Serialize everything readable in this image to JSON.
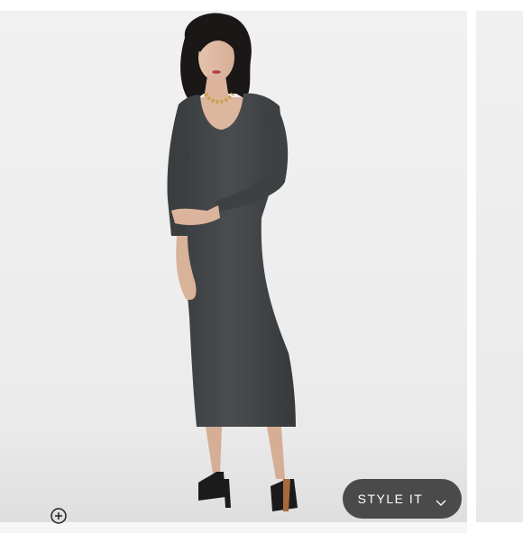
{
  "gallery": {
    "zoom_icon": "zoom-in-icon",
    "style_button": {
      "label": "STYLE IT",
      "icon": "chevron-down-icon",
      "background": "#4a4a4a",
      "text_color": "#ffffff"
    },
    "photo": {
      "subject": "model-wearing-dress",
      "dress_color": "#414446",
      "backdrop_color": "#efefef"
    }
  }
}
